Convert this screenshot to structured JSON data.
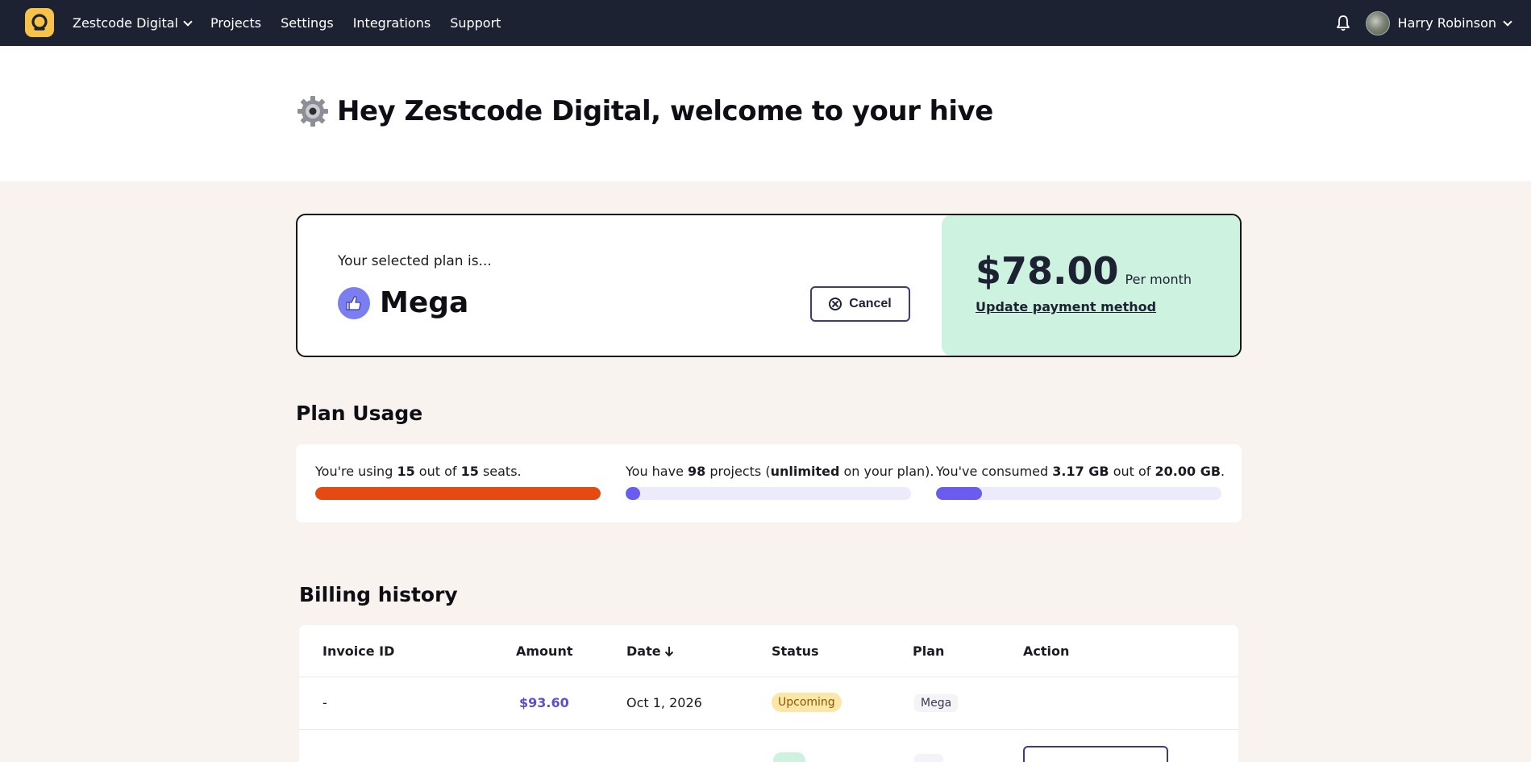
{
  "nav": {
    "org_name": "Zestcode Digital",
    "items": [
      {
        "label": "Projects"
      },
      {
        "label": "Settings"
      },
      {
        "label": "Integrations"
      },
      {
        "label": "Support"
      }
    ],
    "user_name": "Harry Robinson"
  },
  "header": {
    "welcome": "Hey Zestcode Digital, welcome to your hive"
  },
  "plan": {
    "subtitle": "Your selected plan is...",
    "name": "Mega",
    "cancel_label": "Cancel",
    "price": "$78.00",
    "per": "Per month",
    "update_link": "Update payment method"
  },
  "usage": {
    "title": "Plan Usage",
    "seats": {
      "prefix": "You're using ",
      "used": "15",
      "mid": " out of ",
      "total": "15",
      "suffix": " seats.",
      "fraction": 1.0
    },
    "projects": {
      "prefix": "You have ",
      "count": "98",
      "mid": " projects (",
      "limit": "unlimited",
      "suffix": " on your plan).",
      "fraction": 0.05
    },
    "storage": {
      "prefix": "You've consumed ",
      "used": "3.17 GB",
      "mid": " out of ",
      "total": "20.00 GB",
      "suffix": ".",
      "fraction": 0.16
    }
  },
  "billing": {
    "title": "Billing history",
    "columns": [
      "Invoice ID",
      "Amount",
      "Date",
      "Status",
      "Plan",
      "Action"
    ],
    "rows": [
      {
        "invoice_id": "-",
        "amount": "$93.60",
        "date": "Oct 1, 2026",
        "status": "Upcoming",
        "plan": "Mega"
      }
    ]
  },
  "colors": {
    "nav_bg": "#1d2233",
    "accent": "#5b4fd6",
    "seats_bar": "#e44a12",
    "progress_bar": "#6b5cf0",
    "price_panel": "#cdf2df"
  }
}
